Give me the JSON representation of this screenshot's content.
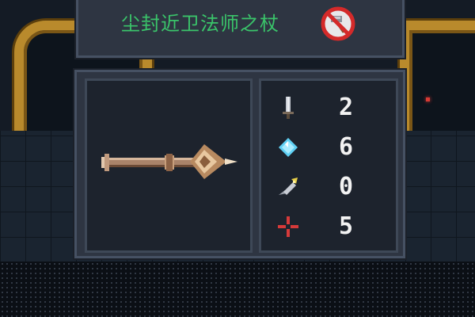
{
  "item": {
    "name": "尘封近卫法师之杖",
    "title_color": "#3ac46a",
    "restriction_icon": "no-hammer-icon"
  },
  "stats": [
    {
      "name": "attack",
      "icon": "sword-icon",
      "value": "2",
      "color": "#c8ccd4"
    },
    {
      "name": "energy",
      "icon": "diamond-icon",
      "value": "6",
      "color": "#5fd0f4"
    },
    {
      "name": "crit",
      "icon": "spark-icon",
      "value": "0",
      "color": "#e8d04a"
    },
    {
      "name": "spread",
      "icon": "crosshair-icon",
      "value": "5",
      "color": "#d63a3a"
    }
  ],
  "weapon": {
    "icon": "staff-icon"
  }
}
